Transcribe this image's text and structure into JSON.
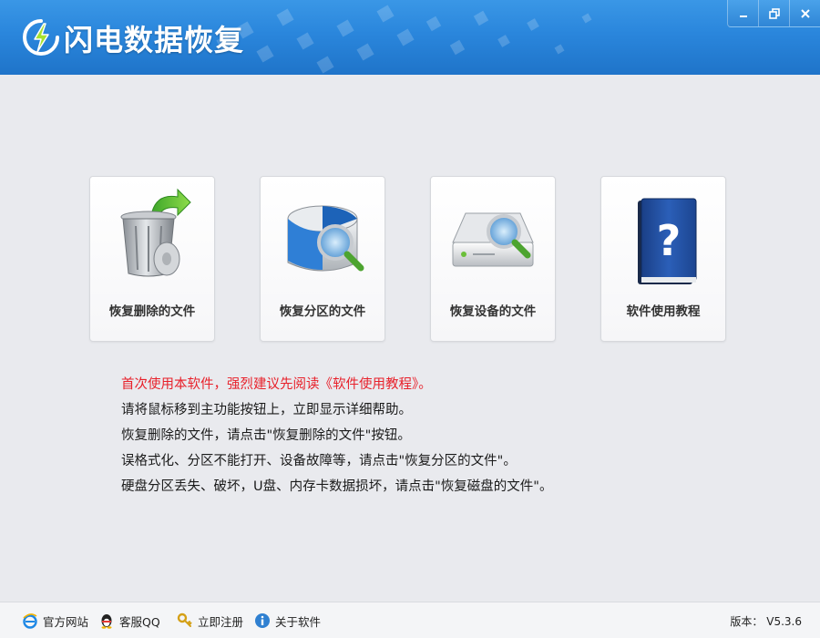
{
  "app": {
    "title": "闪电数据恢复"
  },
  "window_controls": {
    "minimize": "minimize",
    "restore": "restore",
    "close": "close"
  },
  "cards": [
    {
      "label": "恢复删除的文件",
      "icon": "recycle-bin-restore-icon"
    },
    {
      "label": "恢复分区的文件",
      "icon": "partition-search-icon"
    },
    {
      "label": "恢复设备的文件",
      "icon": "device-search-icon"
    },
    {
      "label": "软件使用教程",
      "icon": "help-book-icon"
    }
  ],
  "info": {
    "highlight": "首次使用本软件，强烈建议先阅读《软件使用教程》。",
    "lines": [
      "请将鼠标移到主功能按钮上，立即显示详细帮助。",
      "恢复删除的文件，请点击\"恢复删除的文件\"按钮。",
      "误格式化、分区不能打开、设备故障等，请点击\"恢复分区的文件\"。",
      "硬盘分区丢失、破坏，U盘、内存卡数据损坏，请点击\"恢复磁盘的文件\"。"
    ]
  },
  "statusbar": {
    "links": [
      {
        "label": "官方网站",
        "icon": "ie-browser-icon"
      },
      {
        "label": "客服QQ",
        "icon": "qq-penguin-icon"
      },
      {
        "label": "立即注册",
        "icon": "key-icon"
      },
      {
        "label": "关于软件",
        "icon": "info-icon"
      }
    ],
    "version_label": "版本：",
    "version_value": "V5.3.6"
  },
  "colors": {
    "titlebar": "#2a86dc",
    "highlight_text": "#e8202a",
    "background": "#e9eaee"
  }
}
